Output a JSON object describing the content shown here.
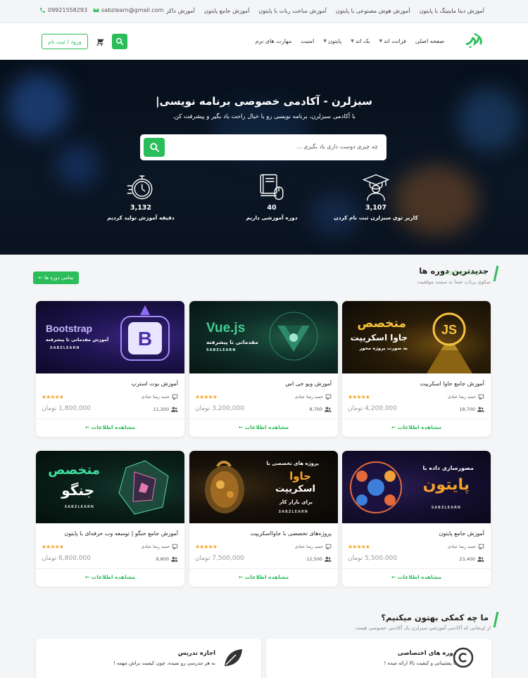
{
  "topbar": {
    "links": [
      "آموزش دیتا ماینینگ با پایتون",
      "آموزش هوش مصنوعی با پایتون",
      "آموزش ساخت ربات با پایتون",
      "آموزش جامع پایتون",
      "آموزش داکر"
    ],
    "email": "sabzlearn@gmail.com",
    "phone": "09921558293"
  },
  "header": {
    "nav": [
      {
        "label": "صفحه اصلی",
        "dropdown": false
      },
      {
        "label": "فرانت اند",
        "dropdown": true
      },
      {
        "label": "بک اند",
        "dropdown": true
      },
      {
        "label": "پایتون",
        "dropdown": true
      },
      {
        "label": "امنیت",
        "dropdown": false
      },
      {
        "label": "مهارت های نرم",
        "dropdown": false
      }
    ],
    "login_label": "ورود / ثبت نام",
    "icons": [
      "logo-icon",
      "cart-icon",
      "search-icon"
    ],
    "accent": "#2bbd5a"
  },
  "hero": {
    "title": "سبزلرن - آکادمی خصوصی برنامه نویسی|",
    "subtitle": "با آکادمی سبزلرن، برنامه نویسی رو با خیال راحت یاد بگیر و پیشرفت کن.",
    "search_placeholder": "چه چیزی دوست داری یاد بگیری ...",
    "stats": [
      {
        "icon": "graduate-icon",
        "value": "3,107",
        "label": "کاربر توی سبزلرن ثبت نام کردن"
      },
      {
        "icon": "book-mouse-icon",
        "value": "40",
        "label": "دوره آموزشی داریم"
      },
      {
        "icon": "stopwatch-icon",
        "value": "3,132",
        "label": "دقیقه آموزش تولید کردیم"
      }
    ]
  },
  "latest": {
    "title": "جدیدترین دوره ها",
    "subtitle": "سکوی پرتاپ شما به سمت موفقیت",
    "all_button": "تمامی دوره ها",
    "more_label": "مشاهده اطلاعات",
    "currency": "تومان",
    "courses": [
      {
        "title": "آموزش جامع جاوا اسکریپت",
        "teacher": "حمید رضا عبادی",
        "students": "18,700",
        "price": "4,200,000",
        "rating": 5,
        "thumb": {
          "line1": "متخصص",
          "line2": "جاوا اسکریپت",
          "line3": "به صورت پروژه محور",
          "badge": "JS"
        }
      },
      {
        "title": "آموزش ویو جی اس",
        "teacher": "حمید رضا عبادی",
        "students": "8,700",
        "price": "3,200,000",
        "rating": 5,
        "thumb": {
          "line1": "Vue.js",
          "line2": "مقدماتی تا پیشرفته",
          "line3": "SABZLEARN"
        }
      },
      {
        "title": "آموزش بوت استرپ",
        "teacher": "حمید رضا عبادی",
        "students": "11,200",
        "price": "1,800,000",
        "rating": 5,
        "thumb": {
          "line1": "Bootstrap",
          "line2": "آموزش مقدماتی تا پیشرفته",
          "line3": "SABZLEARN",
          "badge": "B"
        }
      },
      {
        "title": "آموزش جامع پایتون",
        "teacher": "حمید رضا عبادی",
        "students": "23,400",
        "price": "5,500,000",
        "rating": 5,
        "thumb": {
          "line1": "مصورسازی داده با",
          "line2": "پایتون",
          "line3": "SABZLEARN"
        }
      },
      {
        "title": "پروژه‌های تخصصی با جاوااسکریپت",
        "teacher": "حمید رضا عبادی",
        "students": "12,500",
        "price": "7,500,000",
        "rating": 5,
        "thumb": {
          "line1": "پروژه های تخصصی با",
          "line2": "جاوا",
          "line3": "اسکریپت",
          "line4": "برای بازار کار",
          "line5": "SABZLEARN"
        }
      },
      {
        "title": "آموزش جامع جنگو | توسعه وب حرفه‌ای با پایتون",
        "teacher": "حمید رضا عبادی",
        "students": "9,800",
        "price": "6,800,000",
        "rating": 5,
        "thumb": {
          "line1": "متخصص",
          "line2": "جنگو",
          "line3": "SABZLEARN"
        }
      }
    ]
  },
  "help": {
    "title": "ما چه کمکی بهتون میکنیم؟",
    "subtitle": "از اونجایی که آکادمی آموزشی سبزلرن یک آکادمی خصوصی هست",
    "items": [
      {
        "icon": "copyright-icon",
        "title": "دوره های اختصاصی",
        "text": "با پشتیبانی و کیفیت بالا ارائه میده !"
      },
      {
        "icon": "leaf-icon",
        "title": "اجازه تدریس",
        "text": "به هر مدرسی رو نمیده. چون کیفیت براش مهمه !"
      }
    ]
  }
}
